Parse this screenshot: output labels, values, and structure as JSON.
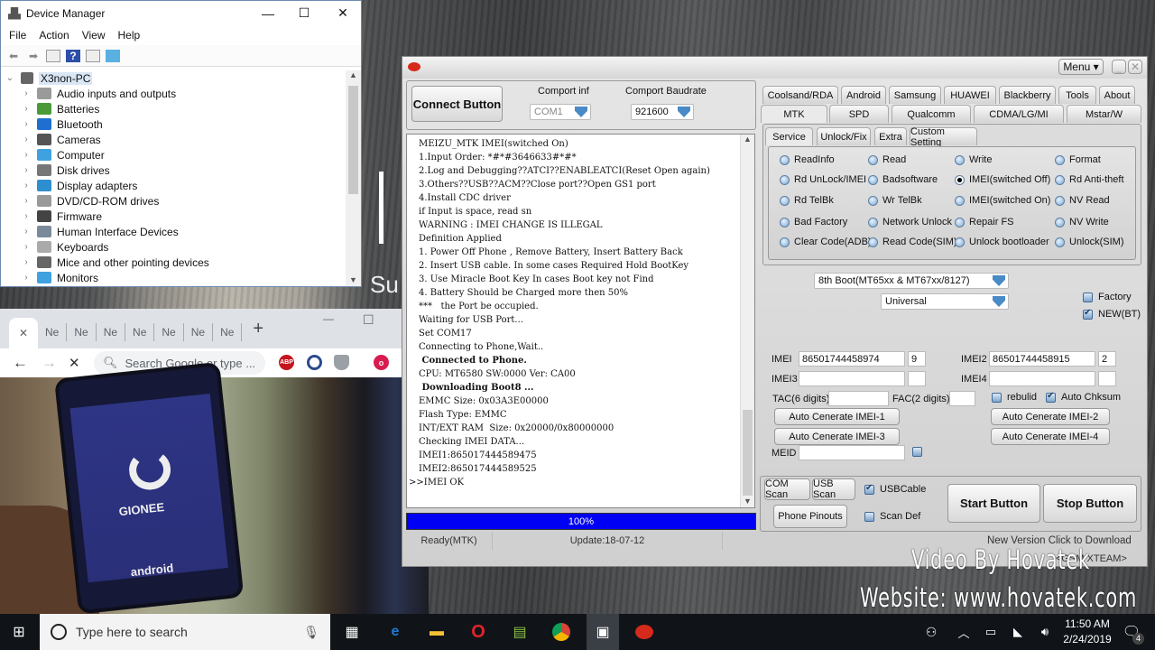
{
  "device_manager": {
    "title": "Device Manager",
    "window_controls": {
      "minimize": "—",
      "maximize": "☐",
      "close": "✕"
    },
    "menu": [
      "File",
      "Action",
      "View",
      "Help"
    ],
    "toolbar_icons": [
      "back-arrow-icon",
      "forward-arrow-icon",
      "properties-icon",
      "help-icon",
      "update-driver-icon",
      "monitor-scan-icon"
    ],
    "root": "X3non-PC",
    "items": [
      {
        "label": "Audio inputs and outputs",
        "icon": "speaker-icon",
        "color": "#9a9a9a"
      },
      {
        "label": "Batteries",
        "icon": "battery-icon",
        "color": "#4a9a3a"
      },
      {
        "label": "Bluetooth",
        "icon": "bluetooth-icon",
        "color": "#1e6fd0"
      },
      {
        "label": "Cameras",
        "icon": "camera-icon",
        "color": "#555555"
      },
      {
        "label": "Computer",
        "icon": "computer-icon",
        "color": "#3fa1e0"
      },
      {
        "label": "Disk drives",
        "icon": "disk-icon",
        "color": "#777777"
      },
      {
        "label": "Display adapters",
        "icon": "display-adapter-icon",
        "color": "#2e8fd0"
      },
      {
        "label": "DVD/CD-ROM drives",
        "icon": "dvd-icon",
        "color": "#999999"
      },
      {
        "label": "Firmware",
        "icon": "firmware-icon",
        "color": "#444444"
      },
      {
        "label": "Human Interface Devices",
        "icon": "hid-icon",
        "color": "#7a8a9a"
      },
      {
        "label": "Keyboards",
        "icon": "keyboard-icon",
        "color": "#aaaaaa"
      },
      {
        "label": "Mice and other pointing devices",
        "icon": "mouse-icon",
        "color": "#666666"
      },
      {
        "label": "Monitors",
        "icon": "monitor-icon",
        "color": "#3fa1e0"
      }
    ]
  },
  "browser": {
    "tab_labels": [
      "Ne",
      "Ne",
      "Ne",
      "Ne",
      "Ne",
      "Ne",
      "Ne"
    ],
    "new_tab": "+",
    "omnibox_placeholder": "Search Google or type ...",
    "profile_initial": "o",
    "extensions": [
      {
        "name": "ABP",
        "color": "#c4161c"
      },
      {
        "name": "",
        "color": "#2b4a8c"
      },
      {
        "name": "",
        "color": "#9aa0a6"
      }
    ]
  },
  "phone_photo": {
    "brand": "GIONEE",
    "os": "android"
  },
  "tool": {
    "menu_label": "Menu ▾",
    "connect_button": "Connect Button",
    "comport_label": "Comport inf",
    "comport_value": "COM1",
    "baud_label": "Comport Baudrate",
    "baud_value": "921600",
    "brand_tabs_row1": [
      "Coolsand/RDA",
      "Android",
      "Samsung",
      "HUAWEI",
      "Blackberry",
      "Tools",
      "About"
    ],
    "brand_tabs_row2": [
      "MTK",
      "SPD",
      "Qualcomm",
      "CDMA/LG/MI",
      "Mstar/W"
    ],
    "active_brand_tab": "MTK",
    "sub_tabs": [
      "Service",
      "Unlock/Fix",
      "Extra",
      "Custom Setting"
    ],
    "active_sub_tab": "Service",
    "service_options": [
      [
        "ReadInfo",
        "Read",
        "Write",
        "Format"
      ],
      [
        "Rd UnLock/IMEI",
        "Badsoftware",
        "IMEI(switched Off)",
        "Rd Anti-theft"
      ],
      [
        "Rd TelBk",
        "Wr TelBk",
        "IMEI(switched On)",
        "NV Read"
      ],
      [
        "Bad Factory",
        "Network Unlock",
        "Repair FS",
        "NV Write"
      ],
      [
        "Clear Code(ADB)",
        "Read Code(SIM)",
        "Unlock bootloader",
        "Unlock(SIM)"
      ]
    ],
    "selected_option": "IMEI(switched Off)",
    "boot_select": "8th Boot(MT65xx & MT67xx/8127)",
    "model_select": "Universal",
    "factory_label": "Factory",
    "factory_checked": false,
    "newbt_label": "NEW(BT)",
    "newbt_checked": true,
    "imei_label": "IMEI",
    "imei_value": "86501744458974",
    "imei_check": "9",
    "imei2_label": "IMEI2",
    "imei2_value": "86501744458915",
    "imei2_check": "2",
    "imei3_label": "IMEI3",
    "imei3_value": "",
    "imei4_label": "IMEI4",
    "imei4_value": "",
    "tac_label": "TAC(6 digits):",
    "tac_value": "",
    "fac_label": "FAC(2 digits):",
    "fac_value": "",
    "rebuild_label": "rebulid",
    "rebuild_checked": false,
    "autochk_label": "Auto Chksum",
    "autochk_checked": true,
    "gen1": "Auto Cenerate IMEI-1",
    "gen2": "Auto Cenerate IMEI-2",
    "gen3": "Auto Cenerate IMEI-3",
    "gen4": "Auto Cenerate IMEI-4",
    "meid_label": "MEID",
    "meid_value": "",
    "com_scan": "COM Scan",
    "usb_scan": "USB Scan",
    "usbcable_label": "USBCable",
    "usbcable_checked": true,
    "phone_pinouts": "Phone Pinouts",
    "scandef_label": "Scan Def",
    "scandef_checked": false,
    "start_button": "Start Button",
    "stop_button": "Stop Button",
    "log_lines": [
      "MEIZU_MTK IMEI(switched On)",
      "1.Input Order: *#*#3646633#*#*",
      "2.Log and Debugging??ATCI??ENABLEATCI(Reset Open again)",
      "3.Others??USB??ACM??Close port??Open GS1 port",
      "4.Install CDC driver",
      "if Input is space, read sn",
      "WARNING : IMEI CHANGE IS ILLEGAL",
      "Definition Applied",
      "1. Power Off Phone , Remove Battery, Insert Battery Back",
      "2. Insert USB cable. In some cases Required Hold BootKey",
      "3. Use Miracle Boot Key In cases Boot key not Find",
      "4. Battery Should be Charged more then 50%",
      "***   the Port be occupied.",
      "Waiting for USB Port...",
      "Set COM17",
      "Connecting to Phone,Wait..",
      " Connected to Phone.",
      "CPU: MT6580 SW:0000 Ver: CA00",
      " Downloading Boot8 ...",
      "EMMC Size: 0x03A3E00000",
      "Flash Type: EMMC",
      "INT/EXT RAM  Size: 0x20000/0x80000000",
      "Checking IMEI DATA...",
      "IMEI1:865017444589475",
      "IMEI2:865017444589525",
      ">>IMEI OK"
    ],
    "progress_percent": 100,
    "progress_label": "100%",
    "status_ready": "Ready(MTK)",
    "status_update": "Update:18-07-12",
    "new_version": "New Version Click to Download",
    "team_label": "<GSM XTEAM>"
  },
  "watermark": {
    "line1": "Video By Hovatek",
    "line2": "Website: www.hovatek.com"
  },
  "taskbar": {
    "search_placeholder": "Type here to search",
    "apps": [
      "task-view-icon",
      "edge-icon",
      "file-explorer-icon",
      "opera-icon",
      "notepad-icon",
      "chrome-icon",
      "app-installer-icon",
      "miracle-box-icon"
    ],
    "time": "11:50 AM",
    "date": "2/24/2019",
    "notification_count": "4"
  }
}
